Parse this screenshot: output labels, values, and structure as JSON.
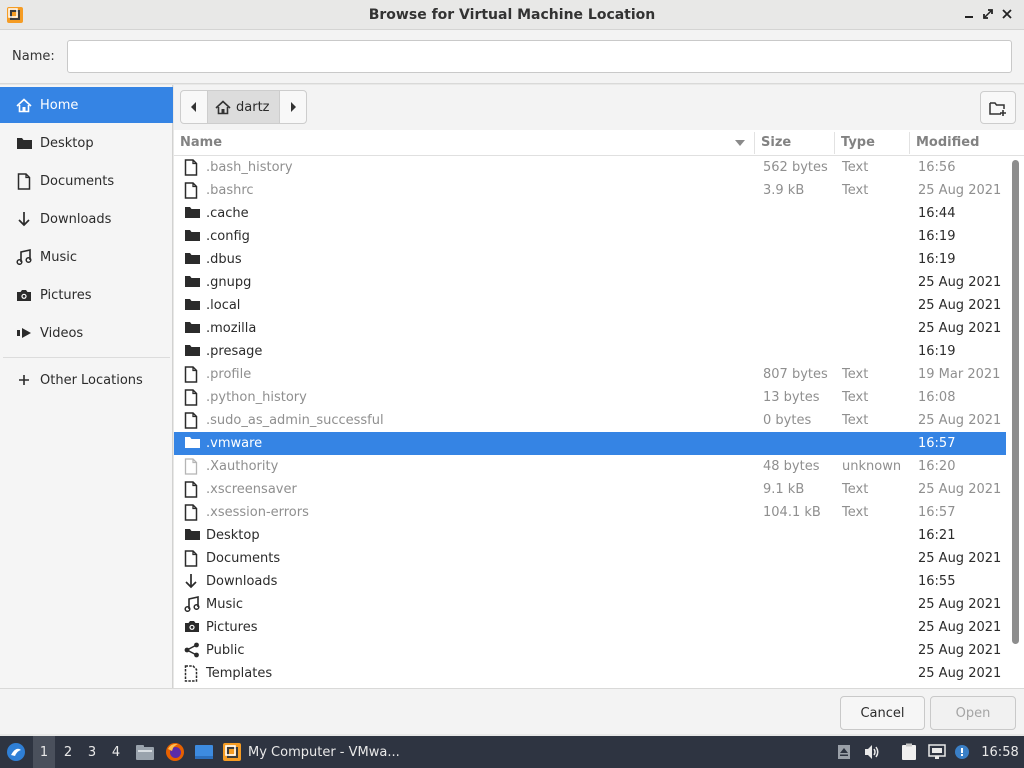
{
  "window": {
    "title": "Browse for Virtual Machine Location",
    "minimize_label": "_",
    "maximize_label": "⤡",
    "close_label": "✕"
  },
  "name_field": {
    "label": "Name:",
    "value": "",
    "placeholder": ""
  },
  "sidebar": {
    "items": [
      {
        "label": "Home",
        "icon": "home-icon",
        "active": true
      },
      {
        "label": "Desktop",
        "icon": "folder-icon"
      },
      {
        "label": "Documents",
        "icon": "document-icon"
      },
      {
        "label": "Downloads",
        "icon": "download-arrow-icon"
      },
      {
        "label": "Music",
        "icon": "music-icon"
      },
      {
        "label": "Pictures",
        "icon": "camera-icon"
      },
      {
        "label": "Videos",
        "icon": "video-icon"
      }
    ],
    "other_locations": {
      "label": "Other Locations",
      "icon": "plus-icon"
    }
  },
  "pathbar": {
    "crumb": "dartz"
  },
  "columns": {
    "name": "Name",
    "size": "Size",
    "type": "Type",
    "modified": "Modified"
  },
  "files": [
    {
      "name": ".bash_history",
      "size": "562 bytes",
      "type": "Text",
      "modified": "16:56",
      "kind": "file",
      "dim": true
    },
    {
      "name": ".bashrc",
      "size": "3.9 kB",
      "type": "Text",
      "modified": "25 Aug 2021",
      "kind": "file",
      "dim": true
    },
    {
      "name": ".cache",
      "size": "",
      "type": "",
      "modified": "16:44",
      "kind": "folder"
    },
    {
      "name": ".config",
      "size": "",
      "type": "",
      "modified": "16:19",
      "kind": "folder"
    },
    {
      "name": ".dbus",
      "size": "",
      "type": "",
      "modified": "16:19",
      "kind": "folder"
    },
    {
      "name": ".gnupg",
      "size": "",
      "type": "",
      "modified": "25 Aug 2021",
      "kind": "folder"
    },
    {
      "name": ".local",
      "size": "",
      "type": "",
      "modified": "25 Aug 2021",
      "kind": "folder"
    },
    {
      "name": ".mozilla",
      "size": "",
      "type": "",
      "modified": "25 Aug 2021",
      "kind": "folder"
    },
    {
      "name": ".presage",
      "size": "",
      "type": "",
      "modified": "16:19",
      "kind": "folder"
    },
    {
      "name": ".profile",
      "size": "807 bytes",
      "type": "Text",
      "modified": "19 Mar 2021",
      "kind": "file",
      "dim": true
    },
    {
      "name": ".python_history",
      "size": "13 bytes",
      "type": "Text",
      "modified": "16:08",
      "kind": "file",
      "dim": true
    },
    {
      "name": ".sudo_as_admin_successful",
      "size": "0 bytes",
      "type": "Text",
      "modified": "25 Aug 2021",
      "kind": "file",
      "dim": true
    },
    {
      "name": ".vmware",
      "size": "",
      "type": "",
      "modified": "16:57",
      "kind": "folder",
      "selected": true
    },
    {
      "name": ".Xauthority",
      "size": "48 bytes",
      "type": "unknown",
      "modified": "16:20",
      "kind": "file-blank",
      "dim": true
    },
    {
      "name": ".xscreensaver",
      "size": "9.1 kB",
      "type": "Text",
      "modified": "25 Aug 2021",
      "kind": "file",
      "dim": true
    },
    {
      "name": ".xsession-errors",
      "size": "104.1 kB",
      "type": "Text",
      "modified": "16:57",
      "kind": "file",
      "dim": true
    },
    {
      "name": "Desktop",
      "size": "",
      "type": "",
      "modified": "16:21",
      "kind": "folder"
    },
    {
      "name": "Documents",
      "size": "",
      "type": "",
      "modified": "25 Aug 2021",
      "kind": "file"
    },
    {
      "name": "Downloads",
      "size": "",
      "type": "",
      "modified": "16:55",
      "kind": "download"
    },
    {
      "name": "Music",
      "size": "",
      "type": "",
      "modified": "25 Aug 2021",
      "kind": "music"
    },
    {
      "name": "Pictures",
      "size": "",
      "type": "",
      "modified": "25 Aug 2021",
      "kind": "camera"
    },
    {
      "name": "Public",
      "size": "",
      "type": "",
      "modified": "25 Aug 2021",
      "kind": "share"
    },
    {
      "name": "Templates",
      "size": "",
      "type": "",
      "modified": "25 Aug 2021",
      "kind": "template"
    }
  ],
  "buttons": {
    "cancel": "Cancel",
    "open": "Open"
  },
  "taskbar": {
    "workspaces": [
      "1",
      "2",
      "3",
      "4"
    ],
    "active_workspace": "1",
    "window_label": "My Computer - VMwa...",
    "clock": "16:58"
  },
  "colors": {
    "accent": "#3584e4",
    "taskbar": "#2e3441",
    "folder": "#2b2b2b"
  }
}
